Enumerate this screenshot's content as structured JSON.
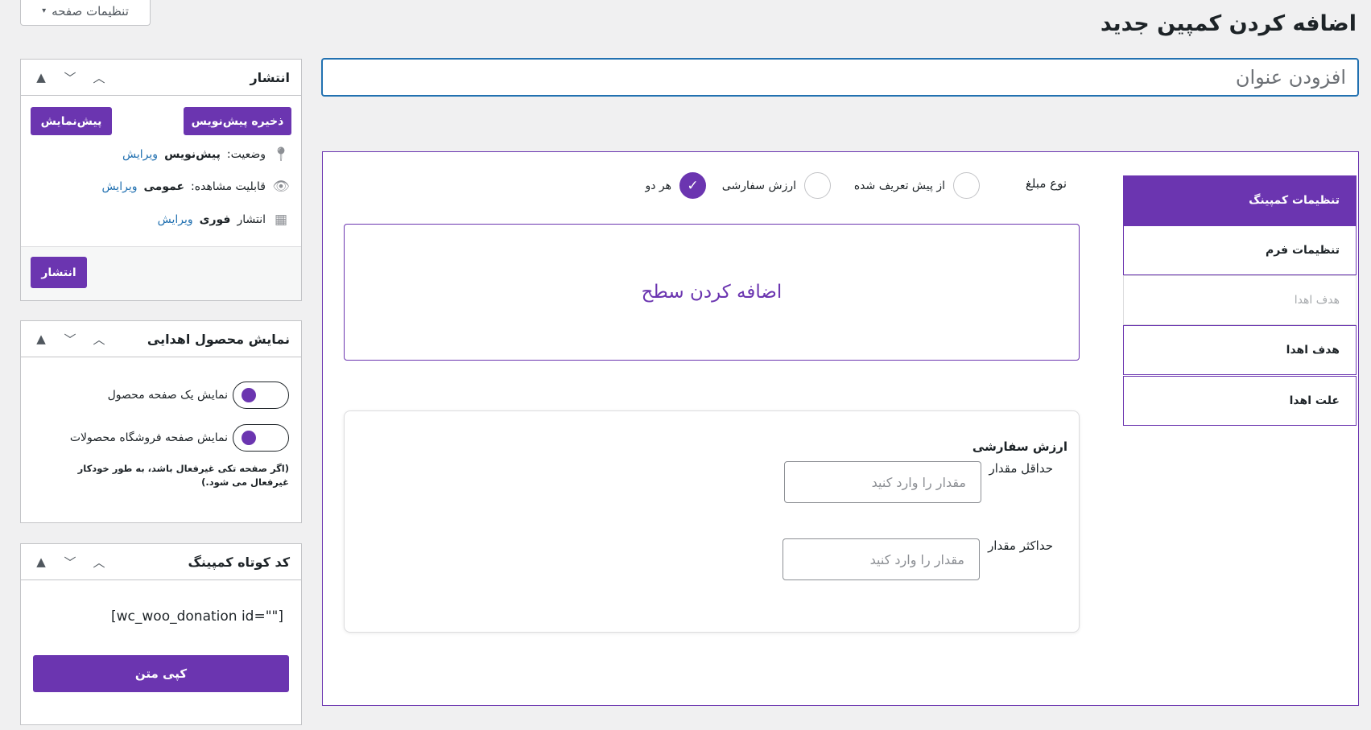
{
  "screen_options": {
    "label": "تنظیمات صفحه",
    "arrow": "▾"
  },
  "page_title": "اضافه کردن کمپین جدید",
  "title_input": {
    "placeholder": "افزودن عنوان",
    "value": ""
  },
  "publish_box": {
    "title": "انتشار",
    "save_draft_label": "ذخیره پیش‌نویس",
    "preview_label": "پیش‌نمایش",
    "status_label": "وضعیت:",
    "status_value": "پیش‌نویس",
    "visibility_label": "قابلیت مشاهده:",
    "visibility_value": "عمومی",
    "publish_time_label": "انتشار",
    "publish_time_value": "فوری",
    "edit_label": "ویرایش",
    "publish_button": "انتشار"
  },
  "display_box": {
    "title": "نمایش محصول اهدایی",
    "toggle1_label": "نمایش یک صفحه محصول",
    "toggle2_label": "نمایش صفحه فروشگاه محصولات",
    "note": "(اگر صفحه تکی غیرفعال باشد، به طور خودکار غیرفعال می شود.)"
  },
  "shortcode_box": {
    "title": "کد کوتاه کمپینگ",
    "shortcode": "[wc_woo_donation id=\"\"]",
    "copy_label": "کپی متن"
  },
  "tabs": [
    {
      "label": "تنظیمات کمپینگ",
      "state": "active"
    },
    {
      "label": "تنظیمات فرم",
      "state": "normal"
    },
    {
      "label": "هدف اهدا",
      "state": "disabled"
    },
    {
      "label": "هدف اهدا",
      "state": "normal"
    },
    {
      "label": "علت اهدا",
      "state": "normal"
    }
  ],
  "amount_type": {
    "label": "نوع مبلغ",
    "options": [
      {
        "label": "از پیش تعریف شده",
        "checked": false
      },
      {
        "label": "ارزش سفارشی",
        "checked": false
      },
      {
        "label": "هر دو",
        "checked": true
      }
    ]
  },
  "add_level_label": "اضافه کردن سطح",
  "custom_value": {
    "title": "ارزش سفارشی",
    "min_label": "حداقل مقدار",
    "min_placeholder": "مقدار را وارد کنید",
    "max_label": "حداکثر مقدار",
    "max_placeholder": "مقدار را وارد کنید"
  },
  "colors": {
    "accent": "#6b35b0",
    "link": "#2271b1",
    "focus_border": "#2271b1"
  }
}
